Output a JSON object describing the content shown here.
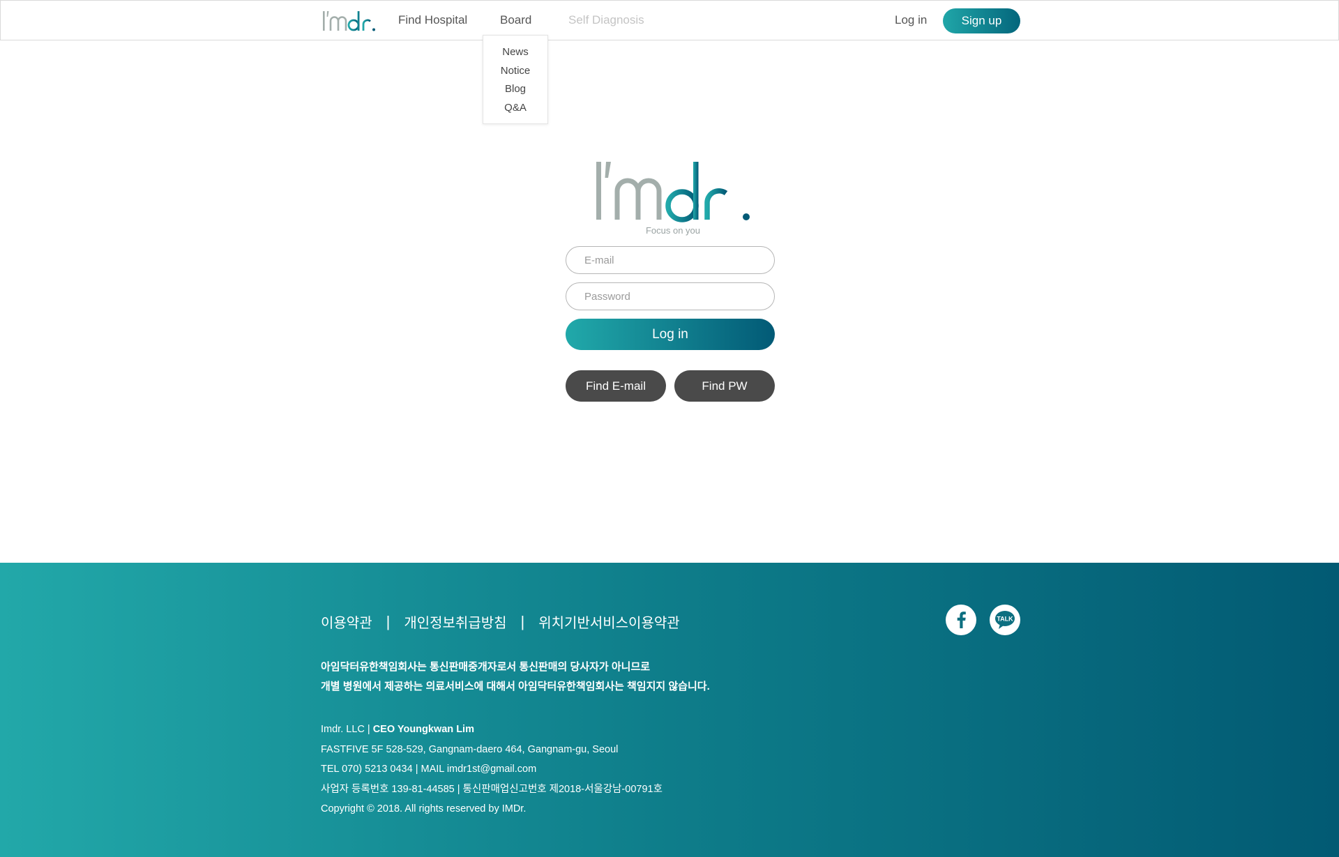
{
  "header": {
    "logo_alt": "I'mdr.",
    "nav": {
      "find_hospital": "Find Hospital",
      "board": "Board",
      "self_diagnosis": "Self Diagnosis"
    },
    "login_label": "Log in",
    "signup_label": "Sign up"
  },
  "board_menu": {
    "items": [
      "News",
      "Notice",
      "Blog",
      "Q&A"
    ]
  },
  "login": {
    "slogan": "Focus on you",
    "email_placeholder": "E-mail",
    "password_placeholder": "Password",
    "login_button": "Log in",
    "find_email_button": "Find E-mail",
    "find_pw_button": "Find PW"
  },
  "footer": {
    "links": [
      "이용약관",
      "개인정보취급방침",
      "위치기반서비스이용약관"
    ],
    "separator": "|",
    "disclaimer": [
      "아임닥터유한책임회사는 통신판매중개자로서 통신판매의 당사자가 아니므로",
      "개별 병원에서 제공하는 의료서비스에 대해서 아임닥터유한책임회사는 책임지지 않습니다."
    ],
    "company_name": "Imdr. LLC |",
    "ceo": "CEO Youngkwan Lim",
    "address": "FASTFIVE 5F 528-529, Gangnam-daero 464, Gangnam-gu, Seoul",
    "contact": "TEL 070) 5213 0434 | MAIL  imdr1st@gmail.com",
    "registration": "사업자 등록번호 139-81-44585 | 통신판매업신고번호 제2018-서울강남-00791호",
    "copyright": "Copyright © 2018. All rights reserved by IMDr.",
    "social_talk_label": "TALK"
  },
  "colors": {
    "accent_start": "#21a9aa",
    "accent_end": "#025a76",
    "logo_gray": "#a3aeab",
    "button_dark": "#4a4a4a"
  },
  "icons": [
    "facebook-icon",
    "kakaotalk-icon"
  ]
}
